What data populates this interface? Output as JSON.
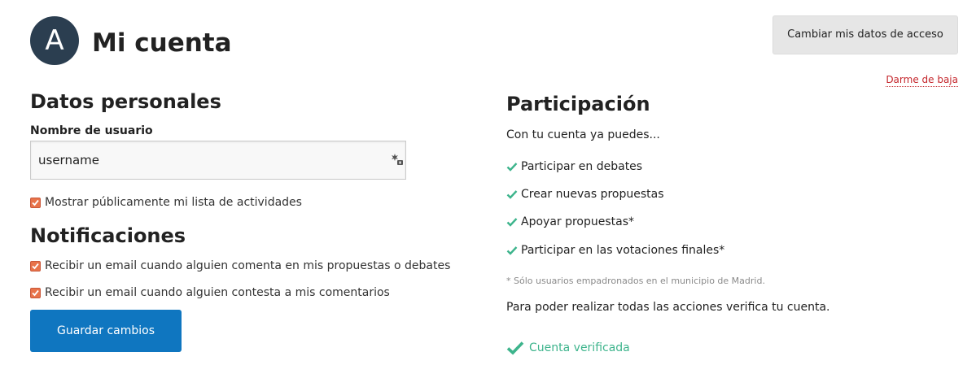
{
  "header": {
    "avatar_letter": "A",
    "title": "Mi cuenta",
    "access_button_label": "Cambiar mis datos de acceso",
    "delete_link_label": "Darme de baja"
  },
  "personal": {
    "heading": "Datos personales",
    "username_label": "Nombre de usuario",
    "username_value": "username",
    "public_activity_label": "Mostrar públicamente mi lista de actividades",
    "public_activity_checked": true
  },
  "notifications": {
    "heading": "Notificaciones",
    "comment_label": "Recibir un email cuando alguien comenta en mis propuestas o debates",
    "comment_checked": true,
    "reply_label": "Recibir un email cuando alguien contesta a mis comentarios",
    "reply_checked": true
  },
  "save_button_label": "Guardar cambios",
  "participation": {
    "heading": "Participación",
    "intro": "Con tu cuenta ya puedes...",
    "features": [
      "Participar en debates",
      "Crear nuevas propuestas",
      "Apoyar propuestas*",
      "Participar en las votaciones finales*"
    ],
    "footnote": "* Sólo usuarios empadronados en el municipio de Madrid.",
    "verify_text": "Para poder realizar todas las acciones verifica tu cuenta.",
    "verified_label": "Cuenta verificada"
  },
  "colors": {
    "avatar_bg": "#2b3e50",
    "primary_button": "#0f76c0",
    "checkbox": "#e8734a",
    "success": "#3db48c",
    "danger_link": "#c4262c"
  },
  "icons": {
    "key": "key-icon",
    "check": "check-icon",
    "checkbox": "checkbox-icon"
  }
}
